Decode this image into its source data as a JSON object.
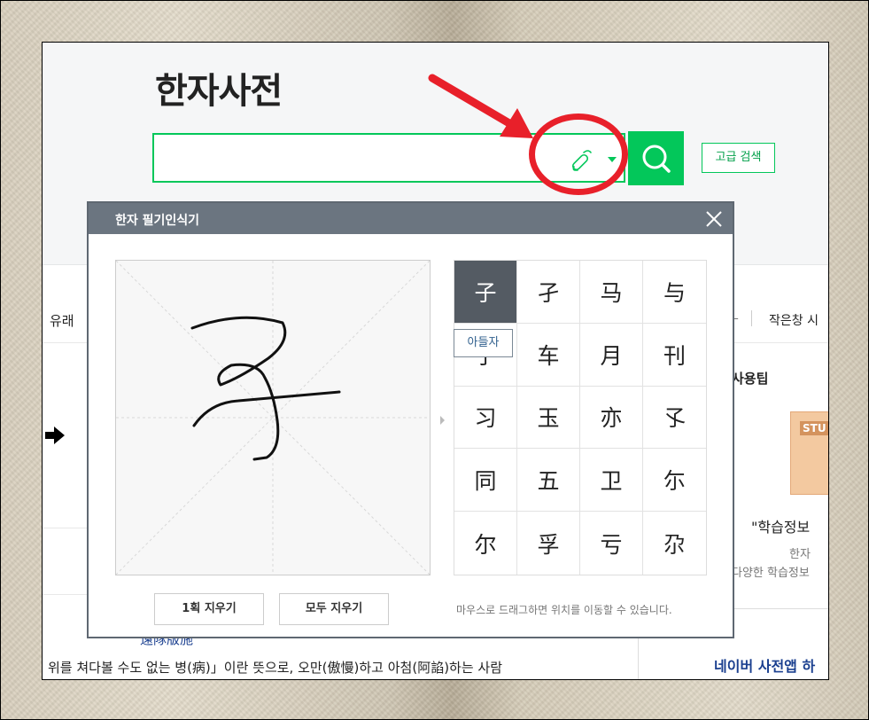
{
  "header": {
    "title": "한자사전",
    "search_placeholder": "",
    "advanced_search_label": "고급 검색"
  },
  "background_page": {
    "tab_left_label": "유래",
    "tab_right_label": "작은창 시",
    "tips_title": "사용팁",
    "study_card_label": "STU",
    "study_caption": "\"학습정보",
    "study_sub1": "한자",
    "study_sub2": "다양한 학습정보",
    "app_link": "네이버 사전앱 하",
    "partial_link": "遠隊版施",
    "bottom_text": "위를 쳐다볼 수도 없는 병(病)」이란 뜻으로, 오만(傲慢)하고 아첨(阿諂)하는 사람"
  },
  "handwriting_popup": {
    "title": "한자 필기인식기",
    "candidates": [
      "子",
      "孑",
      "马",
      "与",
      "子",
      "车",
      "月",
      "刊",
      "习",
      "玉",
      "亦",
      "孓",
      "同",
      "五",
      "卫",
      "尓",
      "尔",
      "孚",
      "亏",
      "尕"
    ],
    "selected_index": 0,
    "tooltip": "아들자",
    "clear_stroke_label": "1획 지우기",
    "clear_all_label": "모두 지우기",
    "drag_hint": "마우스로 드래그하면 위치를 이동할 수 있습니다."
  },
  "colors": {
    "accent": "#03c75a",
    "popup_header": "#6b7580",
    "annotation_red": "#e8202a"
  }
}
